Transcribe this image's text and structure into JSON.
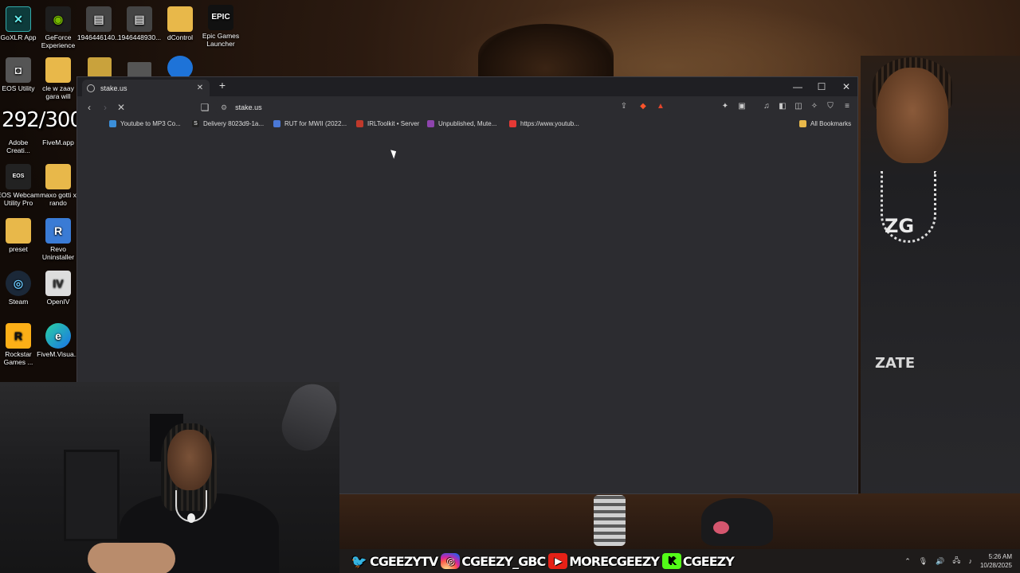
{
  "desktop": {
    "icons": [
      {
        "label": "GoXLR App",
        "icon": "goxlr-icon"
      },
      {
        "label": "GeForce Experience",
        "icon": "nvidia-icon"
      },
      {
        "label": "1946446140...",
        "icon": "video-file-icon"
      },
      {
        "label": "1946448930...",
        "icon": "video-file-icon"
      },
      {
        "label": "dControl",
        "icon": "folder-icon"
      },
      {
        "label": "Epic Games Launcher",
        "icon": "epic-games-icon"
      },
      {
        "label": "EOS Utility",
        "icon": "eos-utility-icon"
      },
      {
        "label": "cle w zaay gara will",
        "icon": "folder-icon"
      },
      {
        "label": "Adobe Creati...",
        "icon": "adobe-icon"
      },
      {
        "label": "FiveM.app",
        "icon": "folder-icon"
      },
      {
        "label": "EOS Webcam Utility Pro",
        "icon": "eos-webcam-icon"
      },
      {
        "label": "maxo gotti x rando",
        "icon": "folder-icon"
      },
      {
        "label": "preset",
        "icon": "folder-icon"
      },
      {
        "label": "Revo Uninstaller",
        "icon": "revo-icon"
      },
      {
        "label": "Steam",
        "icon": "steam-icon"
      },
      {
        "label": "OpenIV",
        "icon": "openiv-icon"
      },
      {
        "label": "Rockstar Games ...",
        "icon": "rockstar-icon"
      },
      {
        "label": "FiveM.Visua...",
        "icon": "edge-icon"
      }
    ],
    "counter": "292/300"
  },
  "browser": {
    "tab_title": "stake.us",
    "url": "stake.us",
    "bookmarks": [
      {
        "label": "Youtube to MP3 Co...",
        "color": "#3b8fd9"
      },
      {
        "label": "Delivery 8023d9-1a...",
        "color": "#222222"
      },
      {
        "label": "RUT for MWII (2022...",
        "color": "#4a78d6"
      },
      {
        "label": "IRLToolkit • Server",
        "color": "#c0392b"
      },
      {
        "label": "Unpublished, Mute...",
        "color": "#8e44ad"
      },
      {
        "label": "https://www.youtub...",
        "color": "#e53935"
      }
    ],
    "all_bookmarks": "All Bookmarks"
  },
  "overlay": {
    "socials": [
      {
        "handle": "CGEEZYTV",
        "icon": "twitter-icon",
        "color": "#1da1f2"
      },
      {
        "handle": "CGEEZY_GBC",
        "icon": "instagram-icon",
        "color": "#c13584"
      },
      {
        "handle": "MORECGEEZY",
        "icon": "youtube-icon",
        "color": "#e62117"
      },
      {
        "handle": "CGEEZY",
        "icon": "kick-icon",
        "color": "#53fc18"
      }
    ]
  },
  "tray": {
    "time": "5:26 AM",
    "date": "10/28/2025"
  }
}
